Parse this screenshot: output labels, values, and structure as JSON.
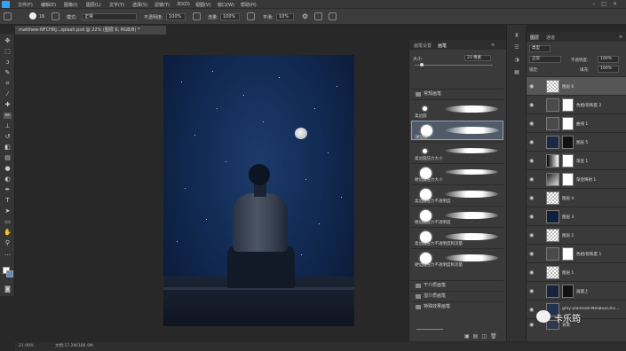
{
  "menu": {
    "logo": "Ps",
    "items": [
      "文件(F)",
      "编辑(E)",
      "图像(I)",
      "图层(L)",
      "文字(Y)",
      "选择(S)",
      "滤镜(T)",
      "3D(D)",
      "视图(V)",
      "窗口(W)",
      "帮助(H)"
    ]
  },
  "options": {
    "size_value": "16",
    "mode_label": "模式:",
    "mode_value": "正常",
    "opacity_label": "不透明度:",
    "opacity_value": "100%",
    "flow_label": "流量:",
    "flow_value": "100%",
    "smooth_label": "平滑:",
    "smooth_value": "10%"
  },
  "document": {
    "tab": "matthew-NFCHRj...splash.psd @ 22% (图层 6, RGB/8) *"
  },
  "brush_panel": {
    "tab1": "画笔设置",
    "tab2": "画笔",
    "size_label": "大小",
    "size_value": "23 像素",
    "group_label": "常规画笔",
    "brushes": [
      "柔边圆",
      "硬边圆",
      "柔边圆压力大小",
      "硬边圆压力大小",
      "柔边圆压力不透明度",
      "硬边圆压力不透明度",
      "柔边圆压力不透明度和流量",
      "硬边圆压力不透明度和流量"
    ],
    "groups": [
      "干介质画笔",
      "湿介质画笔",
      "特殊效果画笔"
    ]
  },
  "layers_panel": {
    "tab1": "图层",
    "tab2": "通道",
    "kind": "类型",
    "blend": "正常",
    "opacity_label": "不透明度:",
    "opacity_value": "100%",
    "lock_label": "锁定:",
    "fill_label": "填充:",
    "fill_value": "100%",
    "layers": [
      "图层 6",
      "色相/饱和度 2",
      "曲线 1",
      "图层 5",
      "渐变 1",
      "渐变映射 1",
      "图层 4",
      "图层 3",
      "图层 2",
      "色相/饱和度 1",
      "图层 1",
      "画面上",
      "grey-jeanssee-NesBuuChic...",
      "背景"
    ]
  },
  "status": {
    "zoom": "21.99%",
    "doc_info": "文档:17.2M/186.9M"
  },
  "watermark": {
    "text": "卡乐筠"
  }
}
